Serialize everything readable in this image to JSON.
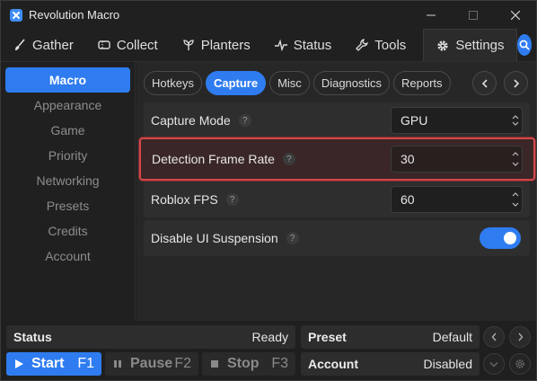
{
  "window": {
    "title": "Revolution Macro"
  },
  "tabs": [
    {
      "label": "Gather",
      "icon": "brush-icon"
    },
    {
      "label": "Collect",
      "icon": "ticket-icon"
    },
    {
      "label": "Planters",
      "icon": "plant-icon"
    },
    {
      "label": "Status",
      "icon": "pulse-icon"
    },
    {
      "label": "Tools",
      "icon": "wrench-icon"
    },
    {
      "label": "Settings",
      "icon": "gear-icon",
      "active": true
    }
  ],
  "sidebar": {
    "items": [
      "Macro",
      "Appearance",
      "Game",
      "Priority",
      "Networking",
      "Presets",
      "Credits",
      "Account"
    ],
    "active": "Macro"
  },
  "subtabs": {
    "items": [
      "Hotkeys",
      "Capture",
      "Misc",
      "Diagnostics",
      "Reports"
    ],
    "active": "Capture"
  },
  "settings": {
    "capture_mode": {
      "label": "Capture Mode",
      "value": "GPU"
    },
    "detection_frame_rate": {
      "label": "Detection Frame Rate",
      "value": "30"
    },
    "roblox_fps": {
      "label": "Roblox FPS",
      "value": "60"
    },
    "disable_ui_suspension": {
      "label": "Disable UI Suspension",
      "enabled": true
    }
  },
  "help_glyph": "?",
  "statusbar": {
    "status": {
      "label": "Status",
      "value": "Ready"
    },
    "preset": {
      "label": "Preset",
      "value": "Default"
    },
    "account": {
      "label": "Account",
      "value": "Disabled"
    },
    "start": {
      "label": "Start",
      "key": "F1"
    },
    "pause": {
      "label": "Pause",
      "key": "F2"
    },
    "stop": {
      "label": "Stop",
      "key": "F3"
    }
  },
  "colors": {
    "accent": "#2f7cf0",
    "highlight_border": "#d2484b",
    "background": "#202020"
  }
}
